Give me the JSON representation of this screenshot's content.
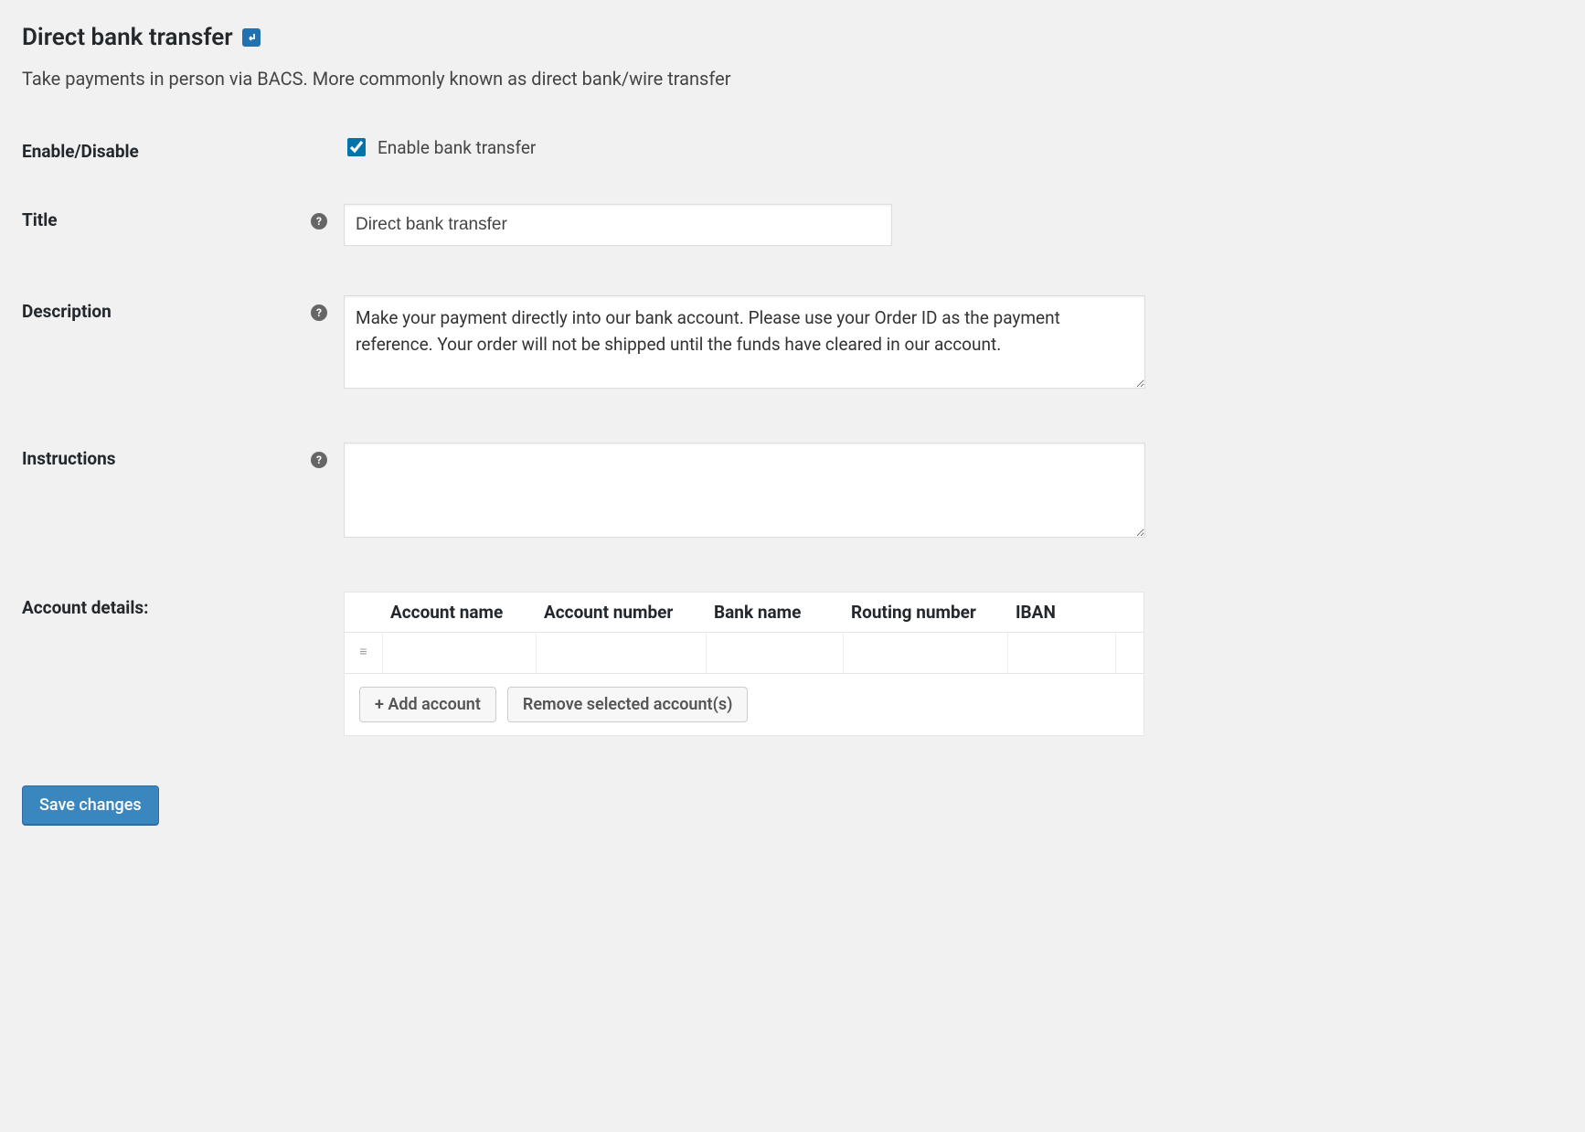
{
  "header": {
    "title": "Direct bank transfer",
    "subtitle": "Take payments in person via BACS. More commonly known as direct bank/wire transfer"
  },
  "form": {
    "enable": {
      "label": "Enable/Disable",
      "checkbox_label": "Enable bank transfer",
      "checked": true
    },
    "title": {
      "label": "Title",
      "value": "Direct bank transfer"
    },
    "description": {
      "label": "Description",
      "value": "Make your payment directly into our bank account. Please use your Order ID as the payment reference. Your order will not be shipped until the funds have cleared in our account."
    },
    "instructions": {
      "label": "Instructions",
      "value": ""
    },
    "account_details": {
      "label": "Account details:",
      "columns": {
        "account_name": "Account name",
        "account_number": "Account number",
        "bank_name": "Bank name",
        "routing_number": "Routing number",
        "iban": "IBAN"
      },
      "rows": [
        {
          "account_name": "",
          "account_number": "",
          "bank_name": "",
          "routing_number": "",
          "iban": ""
        }
      ],
      "add_button": "+ Add account",
      "remove_button": "Remove selected account(s)"
    }
  },
  "actions": {
    "save": "Save changes"
  }
}
